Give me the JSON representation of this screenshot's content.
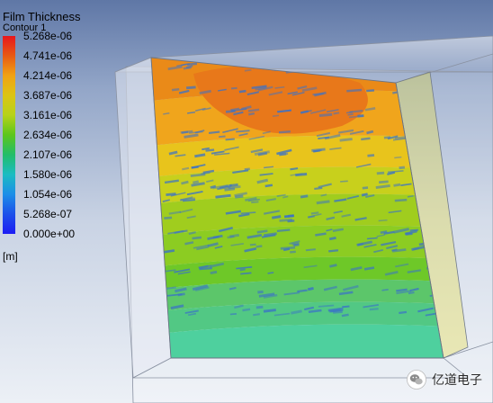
{
  "legend": {
    "title": "Film Thickness",
    "subtitle": "Contour 1",
    "unit": "[m]",
    "levels": [
      {
        "label": "5.268e-06",
        "color": "#e8161c"
      },
      {
        "label": "4.741e-06",
        "color": "#e85a14"
      },
      {
        "label": "4.214e-06",
        "color": "#f0a214"
      },
      {
        "label": "3.687e-06",
        "color": "#dcc414"
      },
      {
        "label": "3.161e-06",
        "color": "#b6d21a"
      },
      {
        "label": "2.634e-06",
        "color": "#5cc61c"
      },
      {
        "label": "2.107e-06",
        "color": "#22bd6a"
      },
      {
        "label": "1.580e-06",
        "color": "#1cbcc2"
      },
      {
        "label": "1.054e-06",
        "color": "#1c8ee8"
      },
      {
        "label": "5.268e-07",
        "color": "#1c50ea"
      },
      {
        "label": "0.000e+00",
        "color": "#1c1cf4"
      }
    ]
  },
  "viewport": {
    "icon": "3d-viewport",
    "bands": [
      {
        "color": "#ea8a18"
      },
      {
        "color": "#f0a51c"
      },
      {
        "color": "#e8c41c"
      },
      {
        "color": "#c8d01c"
      },
      {
        "color": "#a0cd1e"
      },
      {
        "color": "#8ccc22"
      },
      {
        "color": "#6ec828"
      },
      {
        "color": "#5cc66a"
      },
      {
        "color": "#52c884"
      },
      {
        "color": "#4ed09e"
      }
    ],
    "hotspot_color": "#e8781a",
    "streak_color": "#3a72c8"
  },
  "watermark": {
    "text": "亿道电子",
    "icon": "wechat-icon"
  }
}
